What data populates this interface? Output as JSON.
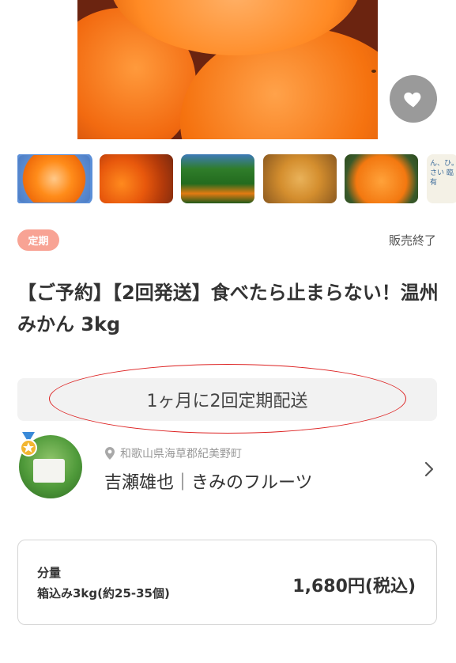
{
  "hero": {
    "image": "mandarin-oranges-photo"
  },
  "favorite": {
    "icon": "heart-icon",
    "bg_color": "#9a9a9a"
  },
  "thumbnails": [
    {
      "subject": "cut-orange"
    },
    {
      "subject": "orange-box"
    },
    {
      "subject": "orange-tree"
    },
    {
      "subject": "mandarin-box"
    },
    {
      "subject": "orange-closeup"
    },
    {
      "subject": "handwritten-note",
      "text": "ん、ひ。 さい 臨 有"
    }
  ],
  "badge": {
    "label": "定期",
    "color": "#f8a394"
  },
  "status": "販売終了",
  "product": {
    "title": "【ご予約】【2回発送】食べたら止まらない！温州みかん 3kg"
  },
  "schedule": {
    "text": "1ヶ月に2回定期配送"
  },
  "producer": {
    "location": "和歌山県海草郡紀美野町",
    "name": "吉瀬雄也｜きみのフルーツ"
  },
  "pricing": {
    "quantity_label": "分量",
    "quantity_value": "箱込み3kg(約25-35個)",
    "price": "1,680円(税込)"
  }
}
